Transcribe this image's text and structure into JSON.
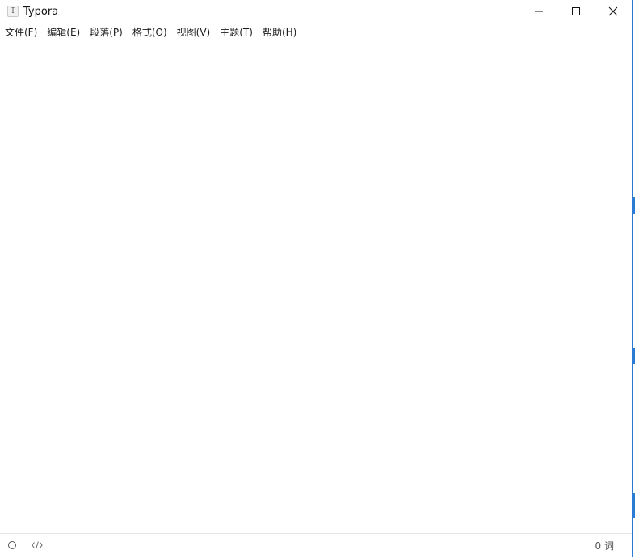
{
  "window": {
    "title": "Typora",
    "app_icon_letter": "T",
    "accent_color": "#2a7bd4"
  },
  "menubar": {
    "items": [
      {
        "label": "文件(F)"
      },
      {
        "label": "编辑(E)"
      },
      {
        "label": "段落(P)"
      },
      {
        "label": "格式(O)"
      },
      {
        "label": "视图(V)"
      },
      {
        "label": "主题(T)"
      },
      {
        "label": "帮助(H)"
      }
    ]
  },
  "editor": {
    "content": ""
  },
  "statusbar": {
    "word_count": "0 词",
    "icons": [
      "outline-toggle-icon",
      "source-code-icon"
    ]
  }
}
